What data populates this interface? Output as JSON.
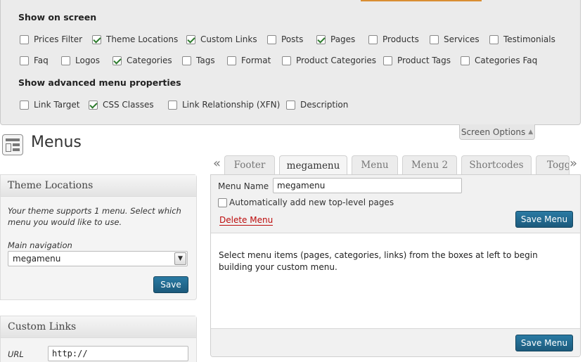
{
  "screen_options": {
    "heading": "Show on screen",
    "row1": [
      {
        "label": "Prices Filter",
        "checked": false
      },
      {
        "label": "Theme Locations",
        "checked": true
      },
      {
        "label": "Custom Links",
        "checked": true
      },
      {
        "label": "Posts",
        "checked": false
      },
      {
        "label": "Pages",
        "checked": true
      },
      {
        "label": "Products",
        "checked": false
      },
      {
        "label": "Services",
        "checked": false
      },
      {
        "label": "Testimonials",
        "checked": false
      }
    ],
    "row2": [
      {
        "label": "Faq",
        "checked": false
      },
      {
        "label": "Logos",
        "checked": false
      },
      {
        "label": "Categories",
        "checked": true
      },
      {
        "label": "Tags",
        "checked": false
      },
      {
        "label": "Format",
        "checked": false
      },
      {
        "label": "Product Categories",
        "checked": false
      },
      {
        "label": "Product Tags",
        "checked": false
      },
      {
        "label": "Categories Faq",
        "checked": false
      }
    ],
    "advanced_heading": "Show advanced menu properties",
    "advanced": [
      {
        "label": "Link Target",
        "checked": false
      },
      {
        "label": "CSS Classes",
        "checked": true
      },
      {
        "label": "Link Relationship (XFN)",
        "checked": false
      },
      {
        "label": "Description",
        "checked": false
      }
    ],
    "toggle_label": "Screen Options",
    "toggle_arrow": "▲"
  },
  "page_title": "Menus",
  "theme_locations": {
    "title": "Theme Locations",
    "description": "Your theme supports 1 menu. Select which menu you would like to use.",
    "field_label": "Main navigation",
    "selected": "megamenu",
    "save_label": "Save"
  },
  "custom_links": {
    "title": "Custom Links",
    "url_label": "URL",
    "url_value": "http://"
  },
  "tabs": {
    "prev_arrow": "«",
    "next_arrow": "»",
    "items": [
      {
        "label": "Footer",
        "active": false
      },
      {
        "label": "megamenu",
        "active": true
      },
      {
        "label": "Menu",
        "active": false
      },
      {
        "label": "Menu 2",
        "active": false
      },
      {
        "label": "Shortcodes",
        "active": false
      },
      {
        "label": "Toggle",
        "active": false
      }
    ]
  },
  "editor": {
    "name_label": "Menu Name",
    "name_value": "megamenu",
    "auto_add_label": "Automatically add new top-level pages",
    "auto_add_checked": false,
    "delete_label": "Delete Menu",
    "save_label": "Save Menu",
    "message": "Select menu items (pages, categories, links) from the boxes at left to begin building your custom menu."
  },
  "colors": {
    "primary_button": "#21759b",
    "delete_link": "#bc0b0b",
    "panel_background": "#ebebeb"
  }
}
